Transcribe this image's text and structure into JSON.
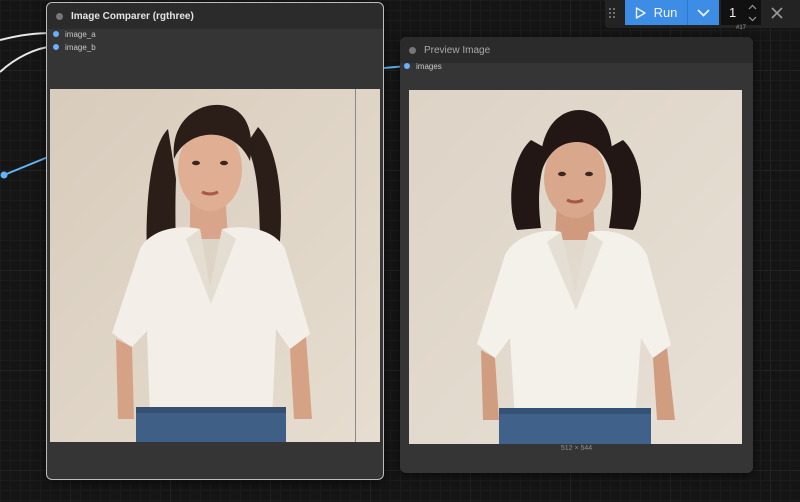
{
  "toolbar": {
    "run_label": "Run",
    "batch_count": "1",
    "badge": "#17"
  },
  "nodes": {
    "comparer": {
      "title": "Image Comparer (rgthree)",
      "inputs": [
        "image_a",
        "image_b"
      ]
    },
    "preview": {
      "title": "Preview Image",
      "inputs": [
        "images"
      ],
      "dimensions": "512 × 544"
    }
  },
  "colors": {
    "slot": "#6ab0ff",
    "link_image": "#64b5f6",
    "link_other": "#e8e8e8",
    "run_button": "#3d8de6",
    "canvas": "#151515"
  },
  "icons": [
    "drag-handle-icon",
    "play-icon",
    "chevron-down-icon",
    "caret-up-icon",
    "caret-down-icon",
    "close-icon"
  ]
}
